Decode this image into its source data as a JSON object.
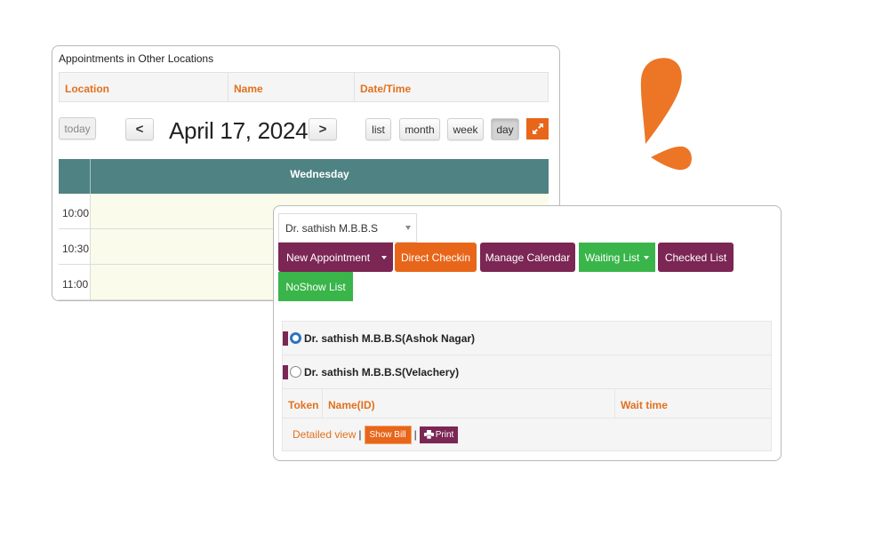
{
  "back_panel": {
    "title": "Appointments in Other Locations",
    "table_headers": [
      "Location",
      "Name",
      "Date/Time"
    ],
    "calendar": {
      "today_label": "today",
      "prev_label": "<",
      "next_label": ">",
      "date_title": "April 17, 2024",
      "views": [
        "list",
        "month",
        "week",
        "day"
      ],
      "active_view": "day",
      "expand_icon": "expand-icon",
      "day_header": "Wednesday",
      "time_slots": [
        "10:00",
        "10:30",
        "11:00"
      ]
    }
  },
  "front_panel": {
    "doctor_select": {
      "value": "Dr. sathish M.B.B.S"
    },
    "actions": {
      "new_appointment": "New Appointment",
      "direct_checkin": "Direct Checkin",
      "manage_calendar": "Manage Calendar",
      "waiting_list": "Waiting List",
      "checked_list": "Checked List",
      "noshow_list": "NoShow List"
    },
    "locations": [
      {
        "label": "Dr. sathish M.B.B.S(Ashok Nagar)",
        "selected": true
      },
      {
        "label": "Dr. sathish M.B.B.S(Velachery)",
        "selected": false
      }
    ],
    "waiting_table_headers": [
      "Token",
      "Name(ID)",
      "Wait time"
    ],
    "footer": {
      "detailed_view": "Detailed view",
      "separator": "|",
      "show_bill": "Show Bill",
      "print": "Print"
    }
  },
  "colors": {
    "accent_orange": "#e8661a",
    "purple": "#7b2654",
    "green": "#39b54a",
    "teal_header": "#4f8282",
    "radio_blue": "#2e73c4"
  }
}
